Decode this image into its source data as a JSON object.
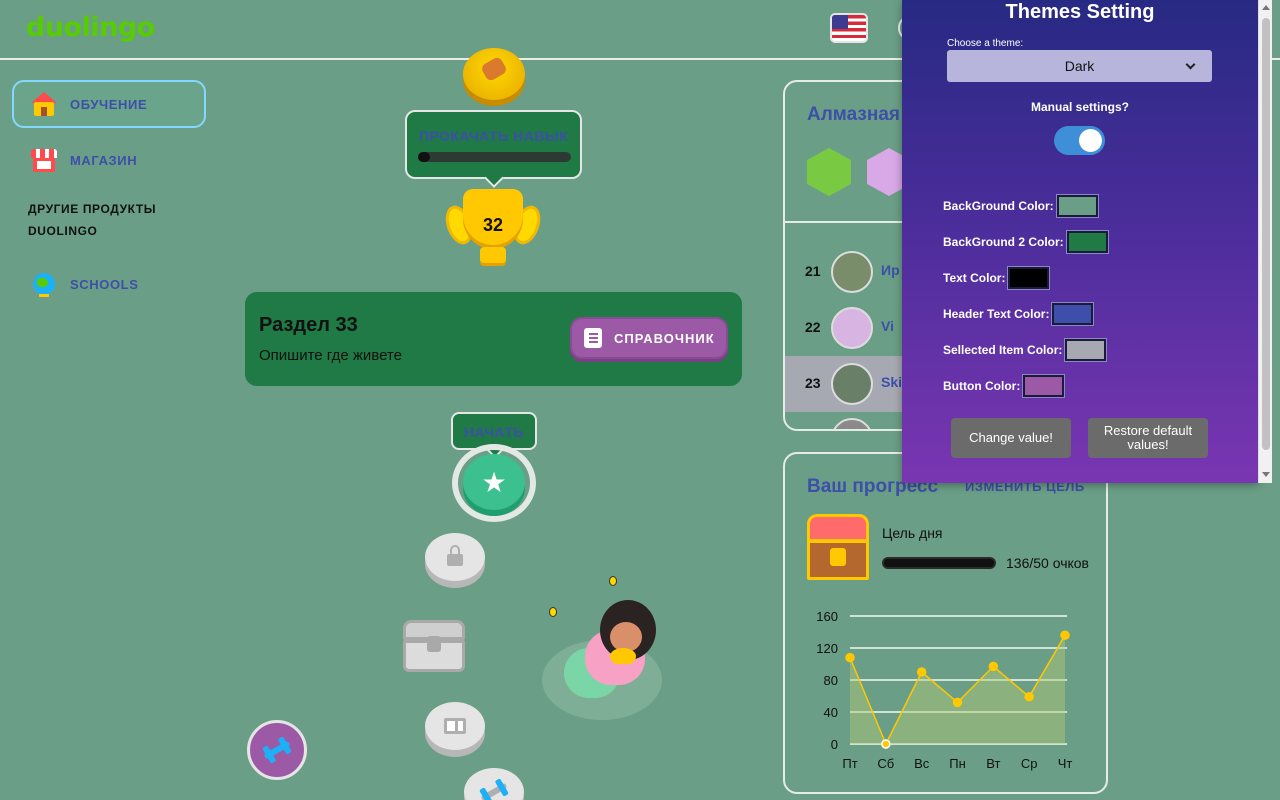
{
  "header": {
    "logo": "duolingo",
    "language_flag": "us-flag-icon"
  },
  "sidebar": {
    "items": [
      {
        "label": "ОБУЧЕНИЕ",
        "icon": "house-icon",
        "active": true
      },
      {
        "label": "МАГАЗИН",
        "icon": "shop-icon",
        "active": false
      }
    ],
    "other_products_title_1": "ДРУГИЕ ПРОДУКТЫ",
    "other_products_title_2": "DUOLINGO",
    "schools_label": "SCHOOLS"
  },
  "path": {
    "levelup_tooltip": "ПРОКАЧАТЬ НАВЫК",
    "levelup_progress": 0.08,
    "trophy_number": "32",
    "unit_title": "Раздел 33",
    "unit_description": "Опишите где живете",
    "guide_button": "СПРАВОЧНИК",
    "start_tooltip": "НАЧАТЬ",
    "star_glyph": "★"
  },
  "league": {
    "title": "Алмазная",
    "rows": [
      {
        "rank": "21",
        "name": "Ир",
        "selected": false
      },
      {
        "rank": "22",
        "name": "Vi",
        "selected": false
      },
      {
        "rank": "23",
        "name": "Ski",
        "selected": true
      }
    ]
  },
  "progress": {
    "title": "Ваш прогресс",
    "edit_goal": "ИЗМЕНИТЬ ЦЕЛЬ",
    "daily_goal_label": "Цель дня",
    "points_text": "136/50 очков",
    "goal_fraction": 1.0
  },
  "chart_data": {
    "type": "area",
    "title": "",
    "xlabel": "",
    "ylabel": "",
    "categories": [
      "Пт",
      "Сб",
      "Вс",
      "Пн",
      "Вт",
      "Ср",
      "Чт"
    ],
    "series": [
      {
        "values": [
          108,
          0,
          90,
          52,
          97,
          59,
          136
        ]
      }
    ],
    "ylim": [
      0,
      160
    ],
    "yticks": [
      "160",
      "120",
      "80",
      "40",
      "0"
    ],
    "grid": true,
    "line_color": "#ffc800"
  },
  "theme_settings": {
    "title": "Themes Setting",
    "choose_label": "Choose a theme:",
    "selected_theme": "Dark",
    "manual_label": "Manual settings?",
    "manual_enabled": true,
    "colors": [
      {
        "label": "BackGround Color:",
        "value": "#6a9e86"
      },
      {
        "label": "BackGround 2 Color:",
        "value": "#1f7a45"
      },
      {
        "label": "Text Color:",
        "value": "#000000"
      },
      {
        "label": "Header Text Color:",
        "value": "#3d4fa8"
      },
      {
        "label": "Sellected Item Color:",
        "value": "#a7a9b2"
      },
      {
        "label": "Button Color:",
        "value": "#9b59a6"
      }
    ],
    "change_button": "Change value!",
    "restore_button_line1": "Restore default",
    "restore_button_line2": "values!"
  }
}
